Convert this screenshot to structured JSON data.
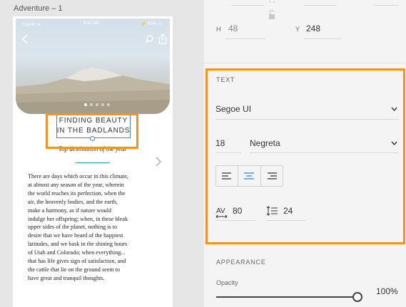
{
  "artboard": {
    "title": "Adventure – 1",
    "status": {
      "carrier": "Carrier ᯤ",
      "time": "9:41 AM",
      "battery": "⚡ 42% ▭"
    },
    "headline_line1": "FINDING BEAUTY",
    "headline_line2": "IN THE BADLANDS",
    "subtitle": "Top destination of the year",
    "body": "There are days which occur in this climate,\nat almost any season of the year, wherein\nthe world reaches its perfection, when the\nair, the heavenly bodies, and the earth,\nmake a harmony, as if nature would\nindulge her offspring; when, in these bleak\nupper sides of the planet, nothing is to\ndesire that we have heard of the happiest\nlatitudes, and we bask in the shining hours\nof Utah and Colorado; when everything...\nthat has life gives sign of satisfaction, and\nthe cattle that lie on the ground seem to\nhave great and tranquil thoughts.",
    "carousel_dots": 5,
    "carousel_active": 0
  },
  "inspector": {
    "transform": {
      "h_label": "H",
      "h_value": "48",
      "y_label": "Y",
      "y_value": "248"
    },
    "text": {
      "section_title": "TEXT",
      "font_family": "Segoe UI",
      "font_size": "18",
      "font_weight": "Negreta",
      "alignment_selected": "center",
      "char_spacing": "80",
      "line_spacing": "24"
    },
    "appearance": {
      "section_title": "APPEARANCE",
      "opacity_label": "Opacity",
      "opacity_value": "100%",
      "opacity_fraction": 1.0
    }
  },
  "colors": {
    "highlight": "#f39322",
    "selection": "#4a7fd1",
    "accent": "#27a3c9",
    "align_active": "#2680eb"
  },
  "icons": [
    "back-icon",
    "search-icon",
    "share-icon",
    "next-icon",
    "chevron-down-icon",
    "align-left-icon",
    "align-center-icon",
    "align-right-icon",
    "lock-icon",
    "character-spacing-icon",
    "line-spacing-icon"
  ]
}
